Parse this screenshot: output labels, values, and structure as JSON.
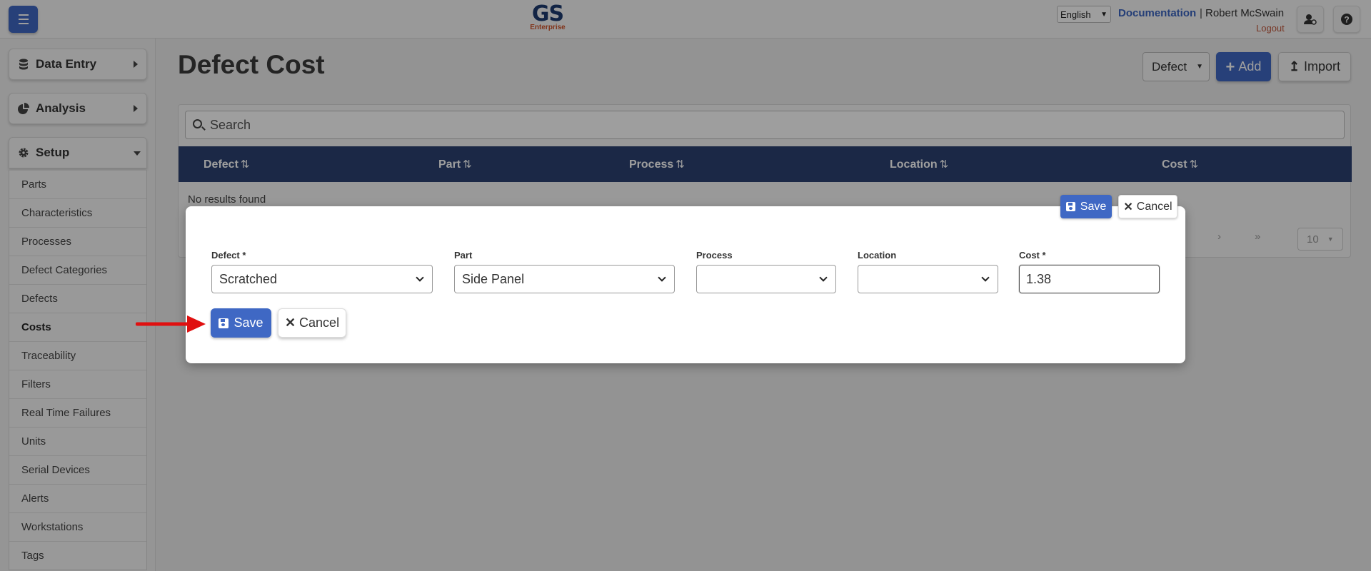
{
  "header": {
    "logo_text": "GS",
    "logo_sub": "Enterprise",
    "language": "English",
    "documentation_label": "Documentation",
    "separator": "|",
    "user_name": "Robert McSwain",
    "logout_label": "Logout",
    "icons": [
      "menu-icon",
      "user-settings-icon",
      "help-icon"
    ]
  },
  "sidebar": {
    "groups": [
      {
        "label": "Data Entry",
        "icon": "database-icon"
      },
      {
        "label": "Analysis",
        "icon": "pie-chart-icon"
      },
      {
        "label": "Setup",
        "icon": "gear-icon"
      }
    ],
    "setup_items": [
      "Parts",
      "Characteristics",
      "Processes",
      "Defect Categories",
      "Defects",
      "Costs",
      "Traceability",
      "Filters",
      "Real Time Failures",
      "Units",
      "Serial Devices",
      "Alerts",
      "Workstations",
      "Tags"
    ],
    "active_item": "Costs"
  },
  "main": {
    "title": "Defect Cost",
    "type_select": "Defect",
    "add_label": "Add",
    "import_label": "Import",
    "search_placeholder": "Search",
    "columns": [
      "Defect",
      "Part",
      "Process",
      "Location",
      "Cost"
    ],
    "no_results": "No results found",
    "pager_next": "›",
    "pager_last": "»",
    "page_size": "10"
  },
  "modal": {
    "top_save": "Save",
    "top_cancel": "Cancel",
    "fields": {
      "defect_label": "Defect *",
      "defect_value": "Scratched",
      "part_label": "Part",
      "part_value": "Side Panel",
      "process_label": "Process",
      "process_value": "",
      "location_label": "Location",
      "location_value": "",
      "cost_label": "Cost *",
      "cost_value": "1.38"
    },
    "save_label": "Save",
    "cancel_label": "Cancel"
  },
  "colors": {
    "primary": "#3f68c4",
    "table_header": "#2c4272",
    "logo_blue": "#1d3b70",
    "logo_orange": "#d0542b",
    "arrow": "#e01010"
  }
}
